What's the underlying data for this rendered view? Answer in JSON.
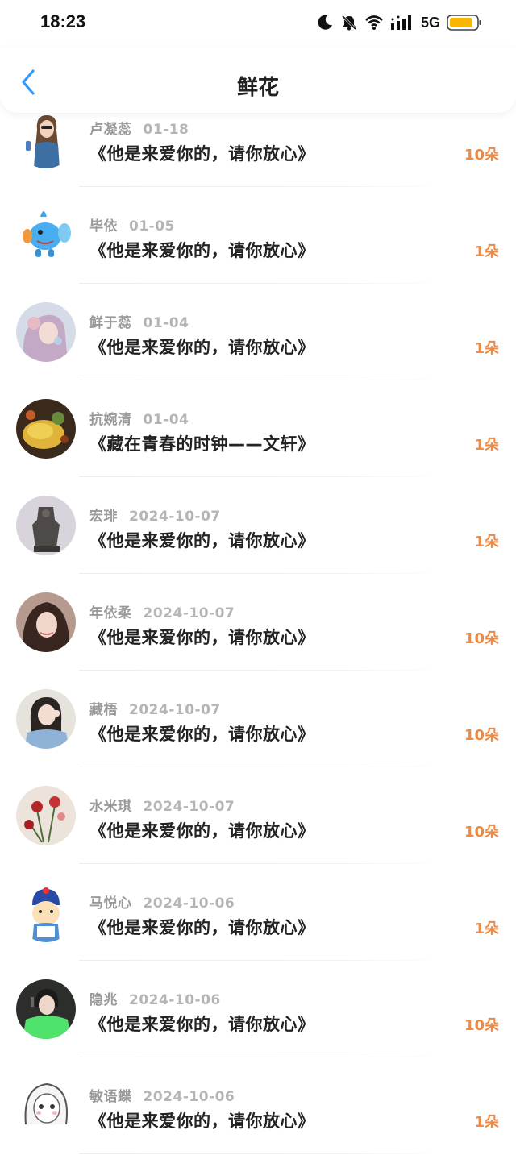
{
  "status_bar": {
    "time": "18:23",
    "network": "5G",
    "icons": [
      "moon-icon",
      "bell-off-icon",
      "wifi-icon",
      "signal-icon",
      "battery-icon"
    ],
    "battery_color": "#f7b500"
  },
  "header": {
    "title": "鲜花",
    "back_icon": "chevron-left-icon",
    "accent": "#2f9bff"
  },
  "colors": {
    "count": "#ee8a44",
    "name": "#9a9a9a",
    "title": "#222222"
  },
  "entries": [
    {
      "name": "卢凝蕊",
      "date": "01-18",
      "title": "《他是来爱你的，请你放心》",
      "count": "10朵",
      "avatar": "avatar-girl-sunglasses"
    },
    {
      "name": "毕依",
      "date": "01-05",
      "title": "《他是来爱你的，请你放心》",
      "count": "1朵",
      "avatar": "avatar-blue-creature"
    },
    {
      "name": "鲜于蕊",
      "date": "01-04",
      "title": "《他是来爱你的，请你放心》",
      "count": "1朵",
      "avatar": "avatar-pastel-girl"
    },
    {
      "name": "抗婉清",
      "date": "01-04",
      "title": "《藏在青春的时钟——文轩》",
      "count": "1朵",
      "avatar": "avatar-food-dish"
    },
    {
      "name": "宏琲",
      "date": "2024-10-07",
      "title": "《他是来爱你的，请你放心》",
      "count": "1朵",
      "avatar": "avatar-bronze-statue"
    },
    {
      "name": "年依柔",
      "date": "2024-10-07",
      "title": "《他是来爱你的，请你放心》",
      "count": "10朵",
      "avatar": "avatar-dark-hair-girl"
    },
    {
      "name": "藏梧",
      "date": "2024-10-07",
      "title": "《他是来爱你的，请你放心》",
      "count": "10朵",
      "avatar": "avatar-girl-denim"
    },
    {
      "name": "水米琪",
      "date": "2024-10-07",
      "title": "《他是来爱你的，请你放心》",
      "count": "10朵",
      "avatar": "avatar-roses"
    },
    {
      "name": "马悦心",
      "date": "2024-10-06",
      "title": "《他是来爱你的，请你放心》",
      "count": "1朵",
      "avatar": "avatar-cartoon-hat"
    },
    {
      "name": "隐兆",
      "date": "2024-10-06",
      "title": "《他是来爱你的，请你放心》",
      "count": "10朵",
      "avatar": "avatar-green-jacket"
    },
    {
      "name": "敏语蝶",
      "date": "2024-10-06",
      "title": "《他是来爱你的，请你放心》",
      "count": "1朵",
      "avatar": "avatar-anime-sketch"
    }
  ]
}
